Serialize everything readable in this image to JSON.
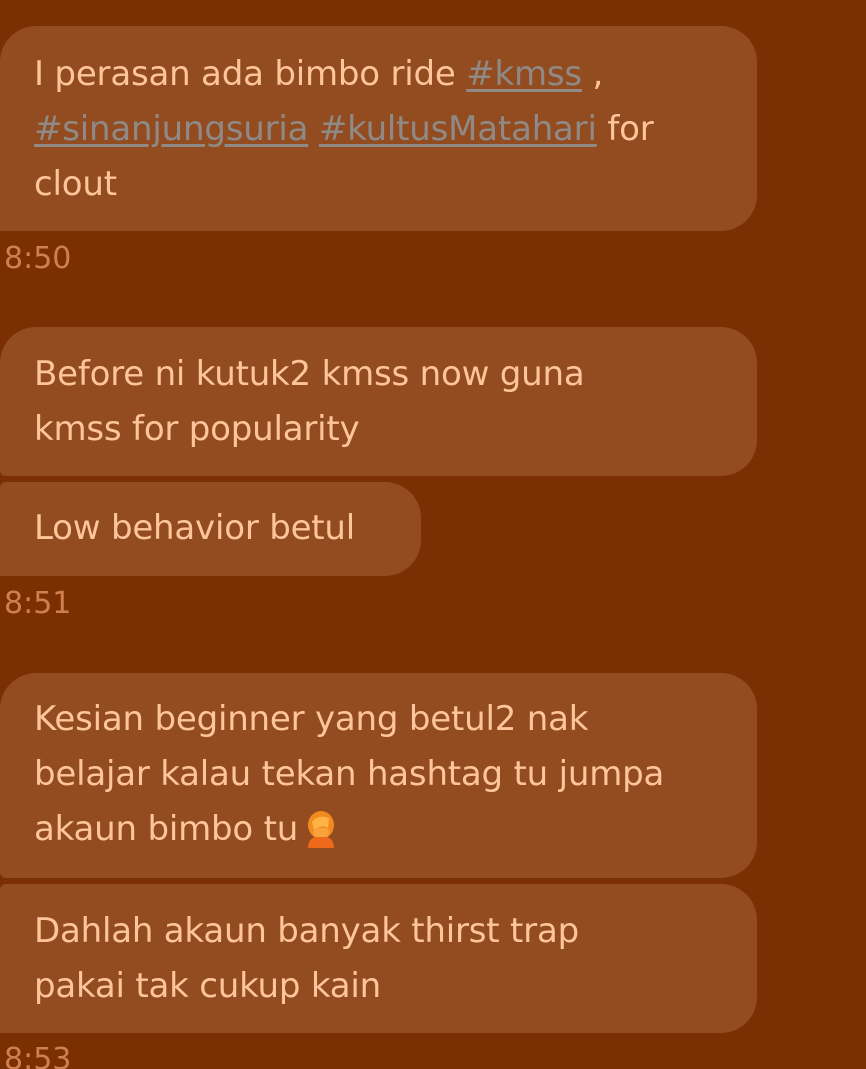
{
  "messages": [
    {
      "segments": [
        {
          "text": "I perasan ada bimbo ride ",
          "link": false
        },
        {
          "text": "#kmss",
          "link": true
        },
        {
          "text": " , ",
          "link": false
        },
        {
          "text": "#sinanjungsuria",
          "link": true
        },
        {
          "text": " ",
          "link": false
        },
        {
          "text": "#kultusMatahari",
          "link": true
        },
        {
          "text": " for clout",
          "link": false
        }
      ]
    },
    {
      "text": "Before ni kutuk2 kmss now guna kmss for popularity"
    },
    {
      "text": "Low behavior betul"
    },
    {
      "text": "Kesian beginner yang betul2 nak belajar kalau tekan hashtag tu jumpa akaun bimbo tu",
      "emoji": "facepalm-emoji"
    },
    {
      "text": "Dahlah akaun banyak thirst trap pakai tak cukup kain"
    }
  ],
  "timestamps": [
    "8:50",
    "8:51",
    "8:53"
  ],
  "colors": {
    "background": "#7a3003",
    "bubble": "#934b20",
    "text": "#ffc59a",
    "timestamp": "#d07f4e",
    "hashtag": "#8f8a86"
  }
}
